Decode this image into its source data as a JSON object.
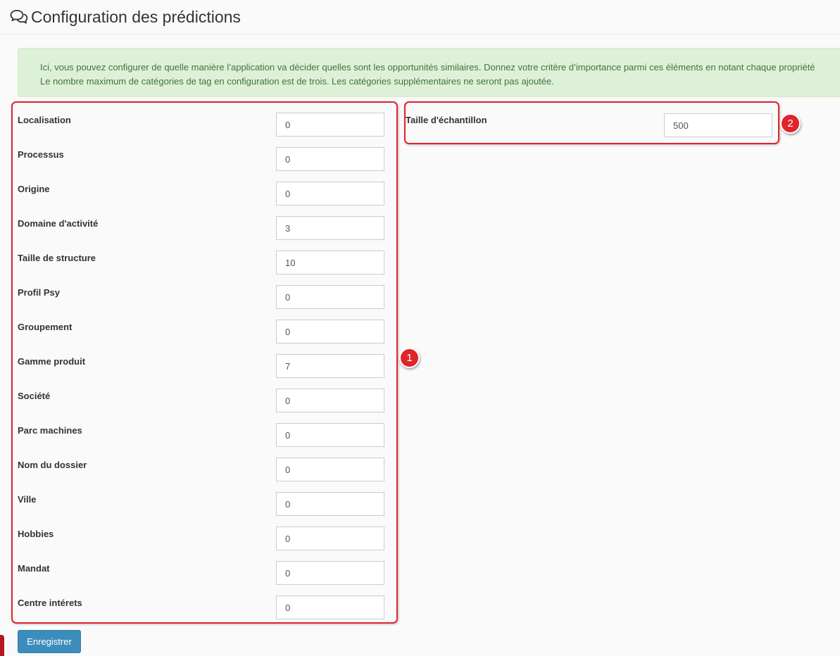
{
  "header": {
    "icon": "comments-icon",
    "title": "Configuration des prédictions"
  },
  "alert": {
    "line1": "Ici, vous pouvez configurer de quelle manière l’application va décider quelles sont les opportunités similaires. Donnez votre critère d’importance parmi ces éléments en notant chaque propriété",
    "line2": "Le nombre maximum de catégories de tag en configuration est de trois. Les catégories supplémentaires ne seront pas ajoutée."
  },
  "criteria": [
    {
      "label": "Localisation",
      "value": "0"
    },
    {
      "label": "Processus",
      "value": "0"
    },
    {
      "label": "Origine",
      "value": "0"
    },
    {
      "label": "Domaine d'activité",
      "value": "3"
    },
    {
      "label": "Taille de structure",
      "value": "10"
    },
    {
      "label": "Profil Psy",
      "value": "0"
    },
    {
      "label": "Groupement",
      "value": "0"
    },
    {
      "label": "Gamme produit",
      "value": "7"
    },
    {
      "label": "Société",
      "value": "0"
    },
    {
      "label": "Parc machines",
      "value": "0"
    },
    {
      "label": "Nom du dossier",
      "value": "0"
    },
    {
      "label": "Ville",
      "value": "0"
    },
    {
      "label": "Hobbies",
      "value": "0"
    },
    {
      "label": "Mandat",
      "value": "0"
    },
    {
      "label": "Centre intérets",
      "value": "0"
    }
  ],
  "sample": {
    "label": "Taille d'échantillon",
    "value": "500"
  },
  "annotations": {
    "badge1": "1",
    "badge2": "2",
    "color": "#e0242b"
  },
  "actions": {
    "save_label": "Enregistrer"
  },
  "colors": {
    "primary": "#3c8dbc",
    "alert_bg": "#dff0d8",
    "alert_text": "#3c763d"
  }
}
